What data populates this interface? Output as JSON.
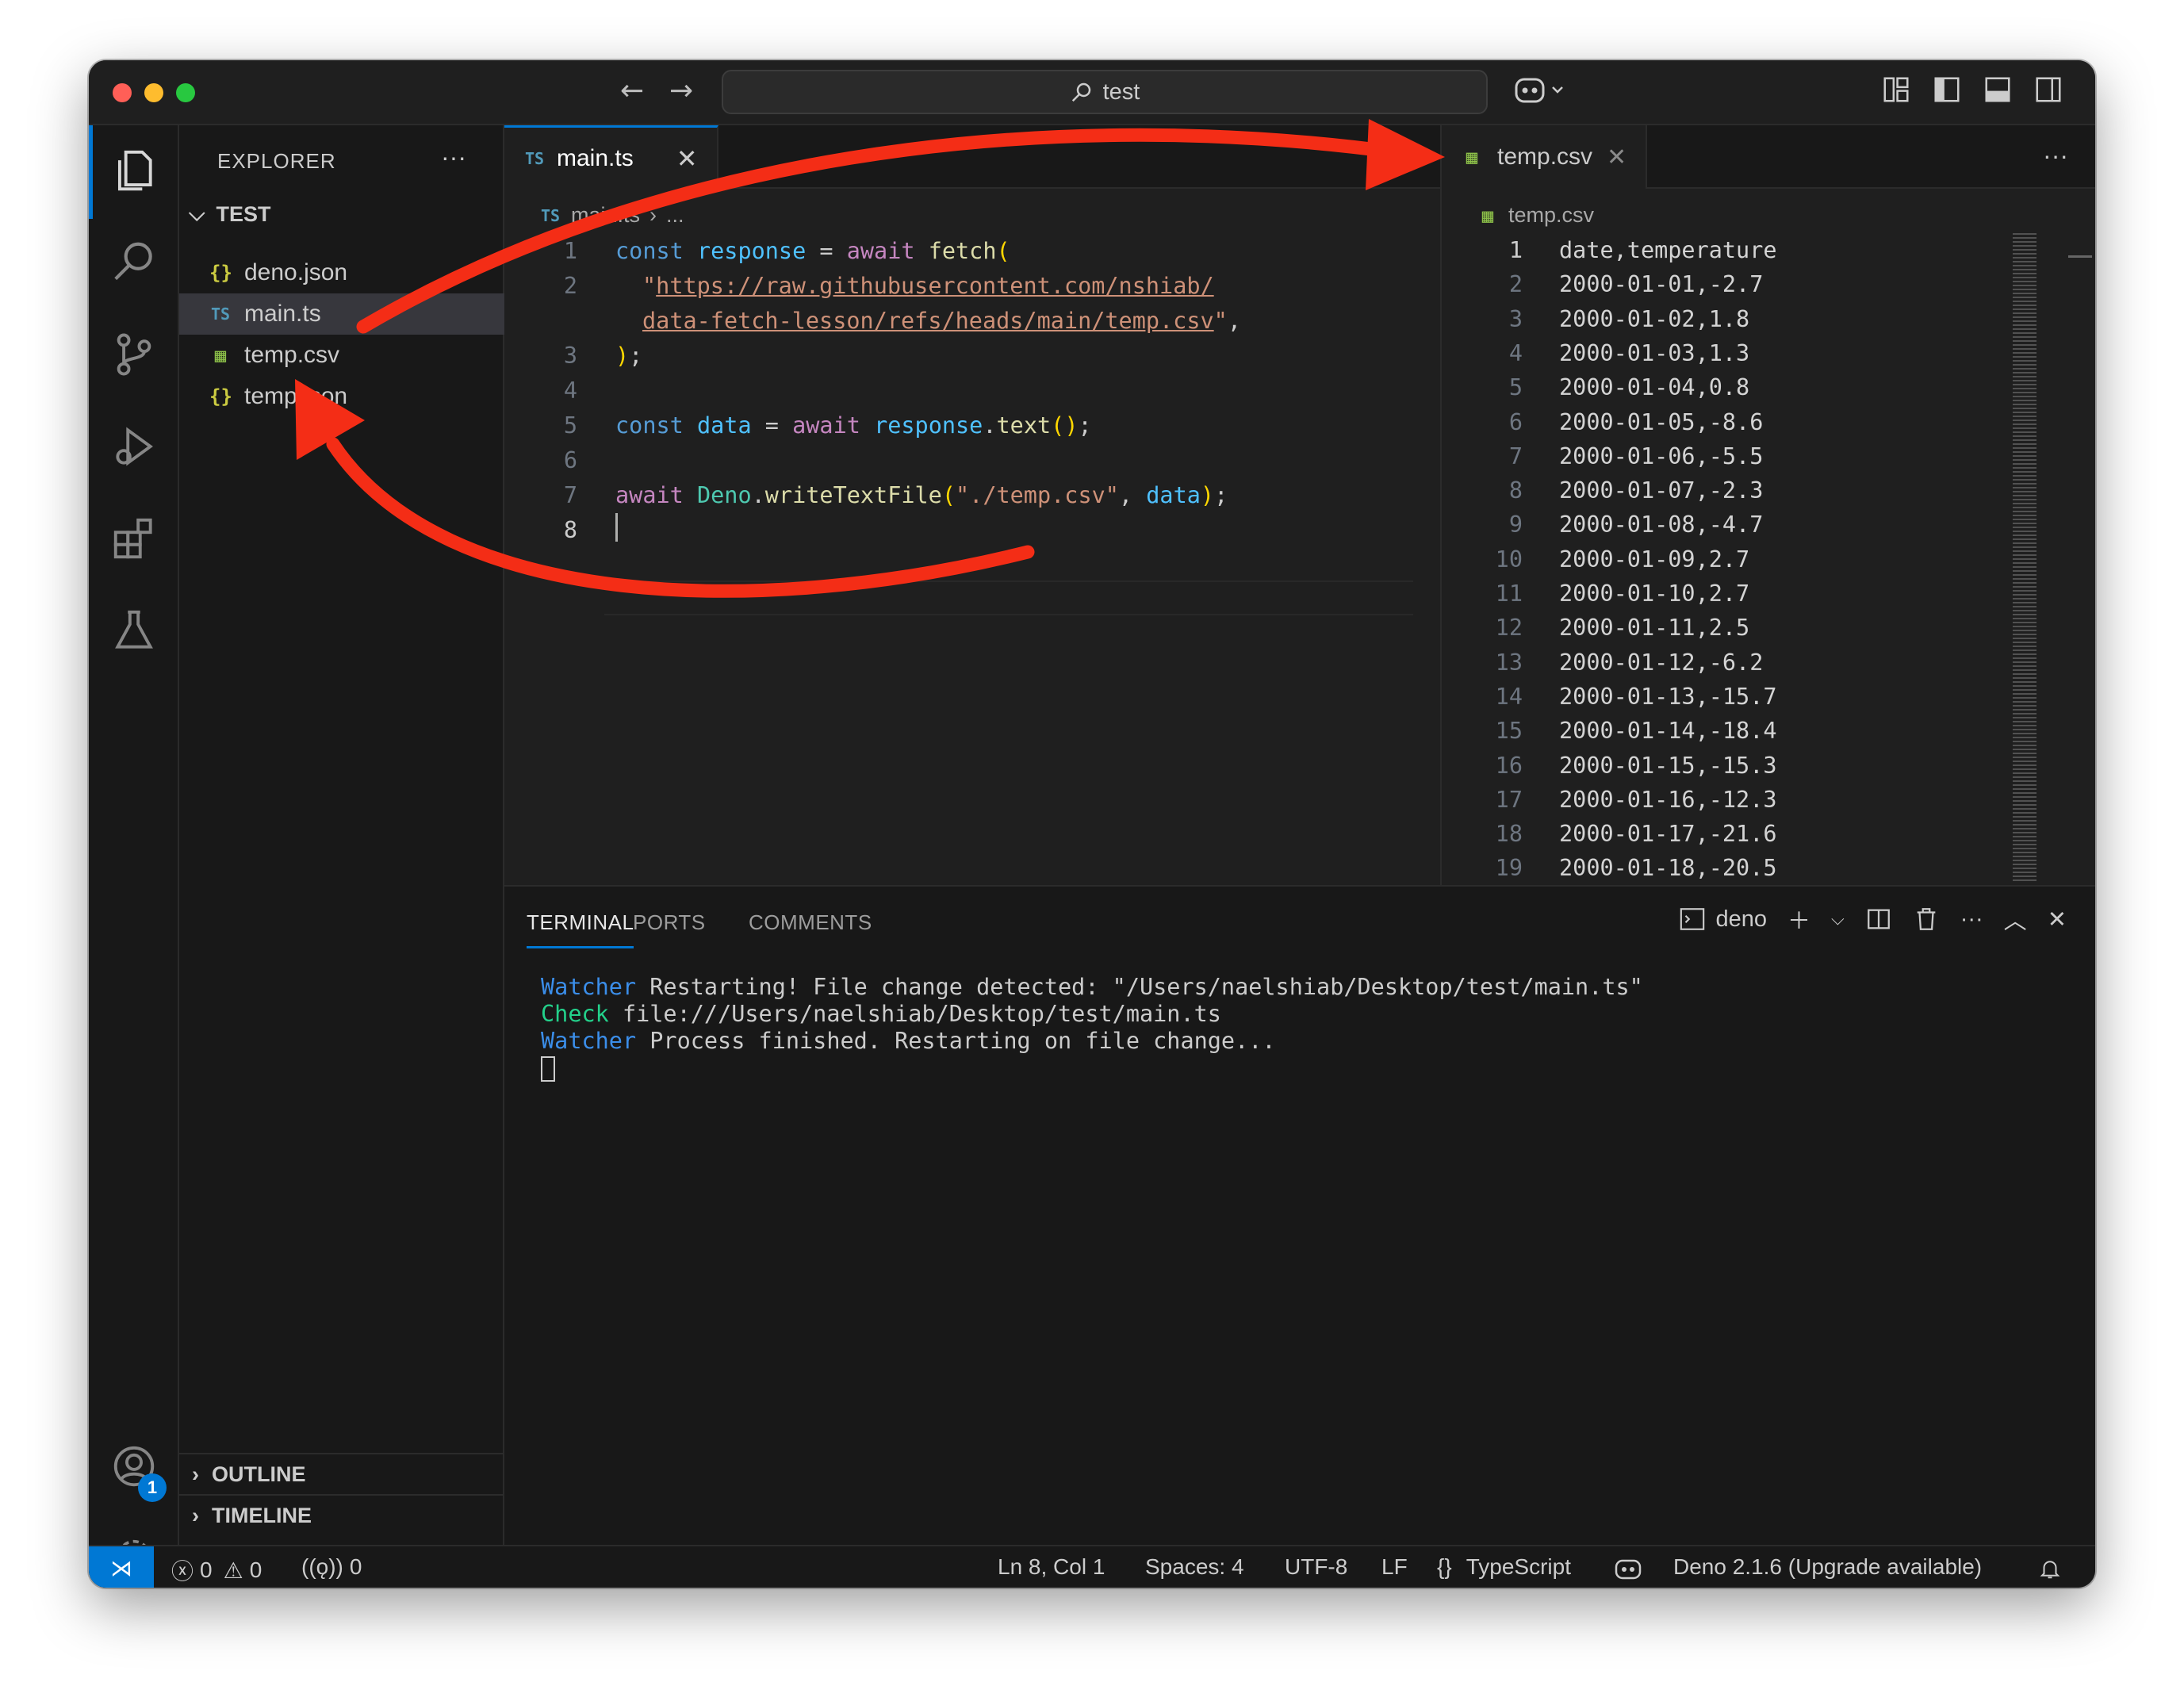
{
  "titlebar": {
    "search_text": "test",
    "back_icon": "arrow-left-icon",
    "forward_icon": "arrow-right-icon"
  },
  "activity_bar": {
    "account_badge": "1"
  },
  "sidebar": {
    "title": "EXPLORER",
    "folder": "TEST",
    "files": [
      {
        "name": "deno.json",
        "icon": "{}",
        "type": "json"
      },
      {
        "name": "main.ts",
        "icon": "TS",
        "type": "ts"
      },
      {
        "name": "temp.csv",
        "icon": "▦",
        "type": "csv"
      },
      {
        "name": "temp.json",
        "icon": "{}",
        "type": "json"
      }
    ],
    "sections": [
      "OUTLINE",
      "TIMELINE"
    ]
  },
  "editor1": {
    "tab_label": "main.ts",
    "tab_icon": "TS",
    "breadcrumb_file": "main.ts",
    "breadcrumb_more": "...",
    "line_numbers": [
      "1",
      "2",
      "",
      "3",
      "4",
      "5",
      "6",
      "7",
      "8"
    ],
    "code": {
      "l1_const": "const",
      "l1_var": "response",
      "l1_eq": " = ",
      "l1_await": "await",
      "l1_fn": "fetch",
      "l1_paren": "(",
      "l2_q1": "\"",
      "l2_url_a": "https://raw.githubusercontent.com/nshiab/",
      "l2_url_b": "data-fetch-lesson/refs/heads/main/temp.csv",
      "l2_q2": "\"",
      "l2_comma": ",",
      "l3_paren": ")",
      "l3_semi": ";",
      "l5_const": "const",
      "l5_var": "data",
      "l5_eq": " = ",
      "l5_await": "await",
      "l5_obj": "response",
      "l5_dot": ".",
      "l5_fn": "text",
      "l5_paren": "()",
      "l5_semi": ";",
      "l7_await": "await",
      "l7_cls": "Deno",
      "l7_dot": ".",
      "l7_fn": "writeTextFile",
      "l7_open": "(",
      "l7_str": "\"./temp.csv\"",
      "l7_comma": ", ",
      "l7_var": "data",
      "l7_close": ")",
      "l7_semi": ";"
    }
  },
  "editor2": {
    "tab_label": "temp.csv",
    "breadcrumb_file": "temp.csv",
    "lines": [
      "date,temperature",
      "2000-01-01,-2.7",
      "2000-01-02,1.8",
      "2000-01-03,1.3",
      "2000-01-04,0.8",
      "2000-01-05,-8.6",
      "2000-01-06,-5.5",
      "2000-01-07,-2.3",
      "2000-01-08,-4.7",
      "2000-01-09,2.7",
      "2000-01-10,2.7",
      "2000-01-11,2.5",
      "2000-01-12,-6.2",
      "2000-01-13,-15.7",
      "2000-01-14,-18.4",
      "2000-01-15,-15.3",
      "2000-01-16,-12.3",
      "2000-01-17,-21.6",
      "2000-01-18,-20.5"
    ],
    "line_numbers": [
      "1",
      "2",
      "3",
      "4",
      "5",
      "6",
      "7",
      "8",
      "9",
      "10",
      "11",
      "12",
      "13",
      "14",
      "15",
      "16",
      "17",
      "18",
      "19"
    ]
  },
  "panel": {
    "tabs": [
      "TERMINAL",
      "PORTS",
      "COMMENTS"
    ],
    "terminal_name": "deno",
    "terminal": {
      "l1_tag": "Watcher",
      "l1_text": " Restarting! File change detected: \"/Users/naelshiab/Desktop/test/main.ts\"",
      "l2_tag": "Check",
      "l2_text": " file:///Users/naelshiab/Desktop/test/main.ts",
      "l3_tag": "Watcher",
      "l3_text": " Process finished. Restarting on file change..."
    }
  },
  "statusbar": {
    "errors": "0",
    "warnings": "0",
    "ports": "0",
    "position": "Ln 8, Col 1",
    "spaces": "Spaces: 4",
    "encoding": "UTF-8",
    "eol": "LF",
    "language": "TypeScript",
    "language_icon": "{}",
    "deno": "Deno 2.1.6 (Upgrade available)"
  },
  "colors": {
    "accent": "#0078d4",
    "annotation_arrow": "#f42d16"
  }
}
